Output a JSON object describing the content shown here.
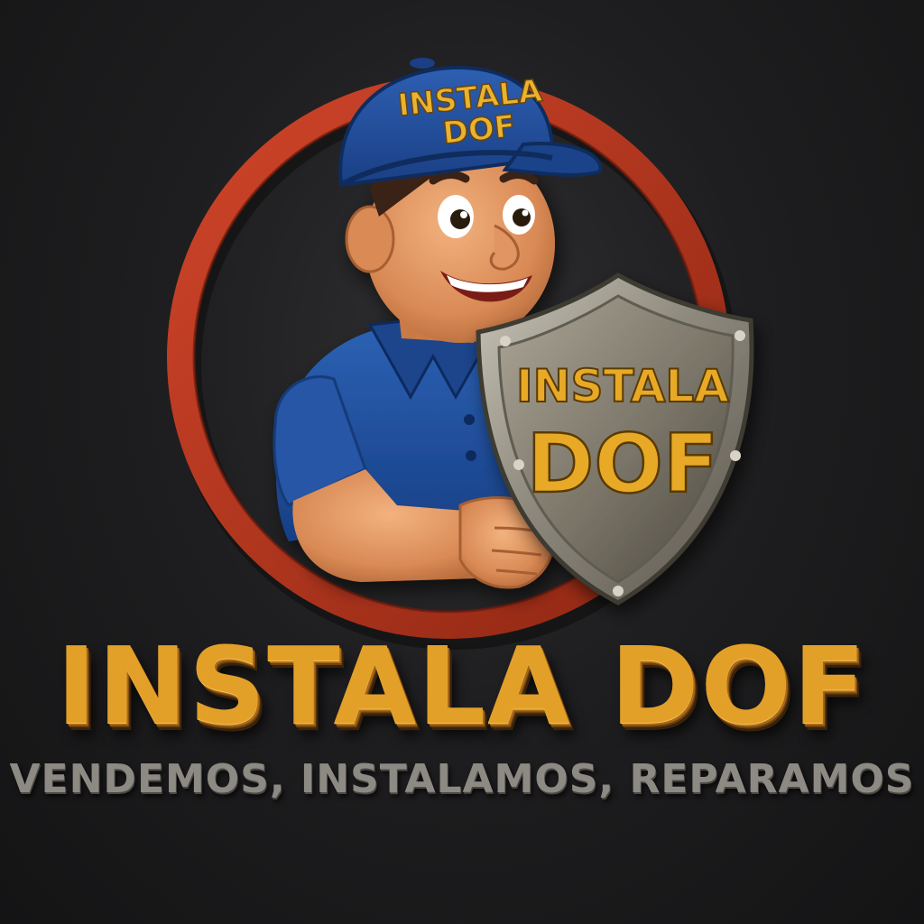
{
  "logo": {
    "cap_text_line1": "INSTALA",
    "cap_text_line2": "DOF",
    "shield_text_line1": "INSTALA",
    "shield_text_line2": "DOF"
  },
  "brand_name": "INSTALA DOF",
  "tagline": "VENDEMOS, INSTALAMOS, REPARAMOS",
  "colors": {
    "background": "#1e1e20",
    "ring": "#b8351f",
    "gold_text": "#e3a028",
    "uniform_blue": "#1e4b96",
    "shield_metal": "#8f8a7e",
    "tagline_gray": "#8d8a84"
  }
}
